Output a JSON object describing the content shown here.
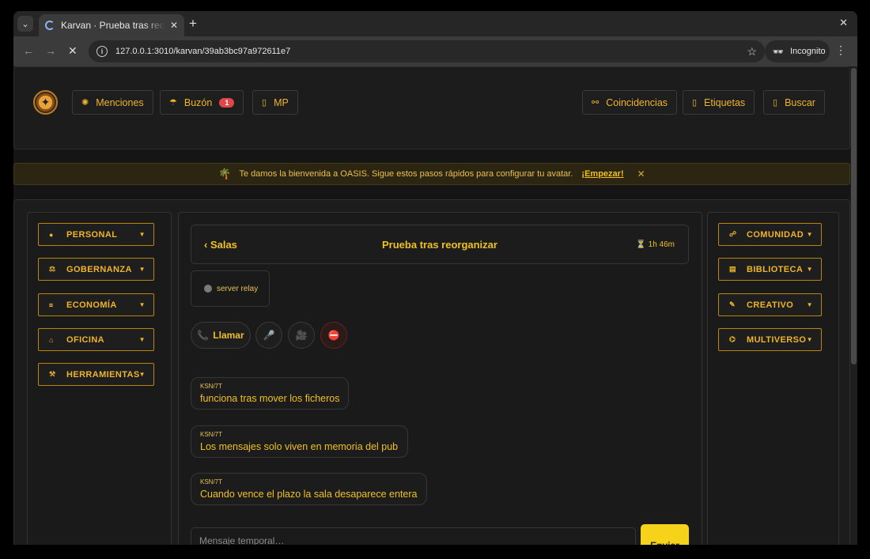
{
  "browser": {
    "tab_title": "Karvan · Prueba tras reorganizar",
    "url": "127.0.0.1:3010/karvan/39ab3bc97a972611e7",
    "incognito_label": "Incognito"
  },
  "topnav": {
    "menciones": "Menciones",
    "buzon": "Buzón",
    "buzon_badge": "1",
    "mp": "MP",
    "coincidencias": "Coincidencias",
    "etiquetas": "Etiquetas",
    "buscar": "Buscar"
  },
  "banner": {
    "text": "Te damos la bienvenida a OASIS. Sigue estos pasos rápidos para configurar tu avatar.",
    "link": "¡Empezar!",
    "close": "✕"
  },
  "left_menu": [
    "PERSONAL",
    "GOBERNANZA",
    "ECONOMÍA",
    "OFICINA",
    "HERRAMIENTAS"
  ],
  "right_menu": [
    "COMUNIDAD",
    "BIBLIOTECA",
    "CREATIVO",
    "MULTIVERSO"
  ],
  "room": {
    "back_label": "‹ Salas",
    "title": "Prueba tras reorganizar",
    "timer": "1h 46m",
    "relay": "server relay",
    "call_label": "Llamar"
  },
  "messages": [
    {
      "author": "KSN/7T",
      "text": "funciona tras mover los ficheros"
    },
    {
      "author": "KSN/7T",
      "text": "Los mensajes solo viven en memoria del pub"
    },
    {
      "author": "KSN/7T",
      "text": "Cuando vence el plazo la sala desaparece entera"
    }
  ],
  "composer": {
    "placeholder": "Mensaje temporal…",
    "send_label": "Enviar"
  }
}
